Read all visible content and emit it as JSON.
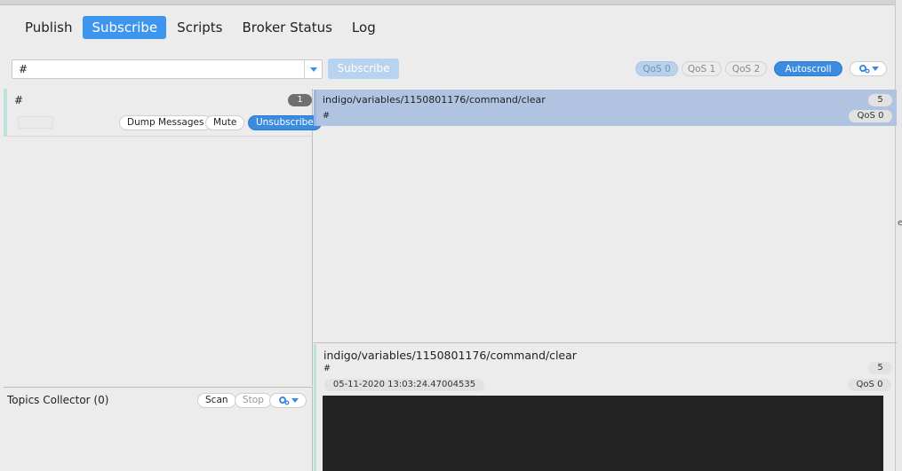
{
  "nav": {
    "tabs": [
      "Publish",
      "Subscribe",
      "Scripts",
      "Broker Status",
      "Log"
    ],
    "active": "Subscribe"
  },
  "subscribe_bar": {
    "topic_value": "#",
    "subscribe_label": "Subscribe",
    "qos0": "QoS 0",
    "qos1": "QoS 1",
    "qos2": "QoS 2",
    "autoscroll": "Autoscroll"
  },
  "subscription": {
    "topic": "#",
    "count": "1",
    "dump_label": "Dump Messages",
    "mute_label": "Mute",
    "unsubscribe_label": "Unsubscribe"
  },
  "collector": {
    "title": "Topics Collector (0)",
    "scan_label": "Scan",
    "stop_label": "Stop"
  },
  "messages": [
    {
      "topic": "indigo/variables/1150801176/command/clear",
      "filter": "#",
      "count": "5",
      "qos": "QoS 0"
    }
  ],
  "detail": {
    "topic": "indigo/variables/1150801176/command/clear",
    "filter": "#",
    "count": "5",
    "timestamp": "05-11-2020  13:03:24.47004535",
    "qos": "QoS 0"
  },
  "edge_fragment": "e",
  "colors": {
    "accent": "#3d96ee",
    "selected_row": "#b0c4e2",
    "payload_bg": "#232323",
    "subscription_marker": "#bfe1dd"
  },
  "icons": [
    "caret-down-icon",
    "gear-icon"
  ]
}
